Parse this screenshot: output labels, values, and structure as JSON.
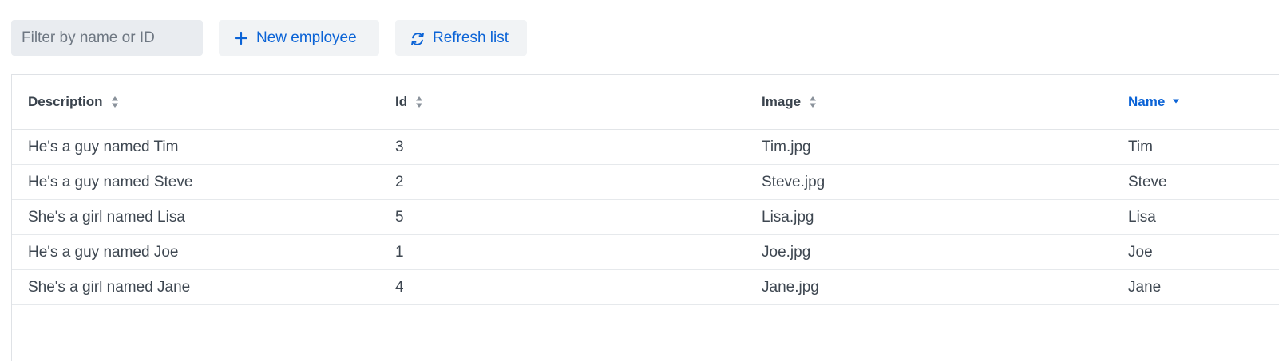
{
  "toolbar": {
    "filter_placeholder": "Filter by name or ID",
    "filter_value": "",
    "new_label": "New employee",
    "refresh_label": "Refresh list",
    "accent_color": "#0b63d6"
  },
  "table": {
    "columns": [
      {
        "label": "Description",
        "sort": "none"
      },
      {
        "label": "Id",
        "sort": "none"
      },
      {
        "label": "Image",
        "sort": "none"
      },
      {
        "label": "Name",
        "sort": "descending"
      }
    ],
    "rows": [
      {
        "description": "He's a guy named Tim",
        "id": "3",
        "image": "Tim.jpg",
        "name": "Tim"
      },
      {
        "description": "He's a guy named Steve",
        "id": "2",
        "image": "Steve.jpg",
        "name": "Steve"
      },
      {
        "description": "She's a girl named Lisa",
        "id": "5",
        "image": "Lisa.jpg",
        "name": "Lisa"
      },
      {
        "description": "He's a guy named Joe",
        "id": "1",
        "image": "Joe.jpg",
        "name": "Joe"
      },
      {
        "description": "She's a girl named Jane",
        "id": "4",
        "image": "Jane.jpg",
        "name": "Jane"
      }
    ]
  },
  "icons": {
    "new": "plus-icon",
    "refresh": "refresh-icon",
    "sort_unsorted": "sort-icon",
    "sort_desc": "sort-descending-icon"
  }
}
